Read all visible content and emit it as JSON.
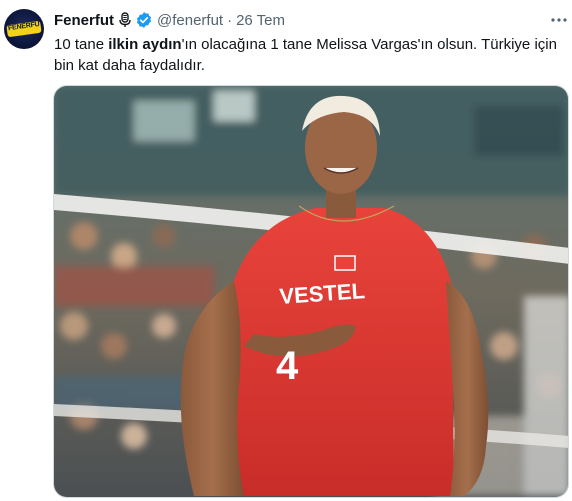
{
  "tweet": {
    "author_name": "Fenerfut",
    "handle": "@fenerfut",
    "separator": "·",
    "time": "26 Tem",
    "text": {
      "part1": "10 tane ",
      "bold": "ilkin aydın",
      "part2": "'ın olacağına 1 tane Melissa Vargas'ın olsun. Türkiye için bin kat daha faydalıdır."
    },
    "avatar_logo_text": "FENERFUT",
    "icons": [
      "mic-icon",
      "verified-icon",
      "more-icon"
    ]
  },
  "media": {
    "jersey_brand": "VESTEL",
    "jersey_number": "4"
  },
  "colors": {
    "accent": "#1d9bf0",
    "secondary_text": "#536471",
    "jersey": "#e43a34"
  }
}
